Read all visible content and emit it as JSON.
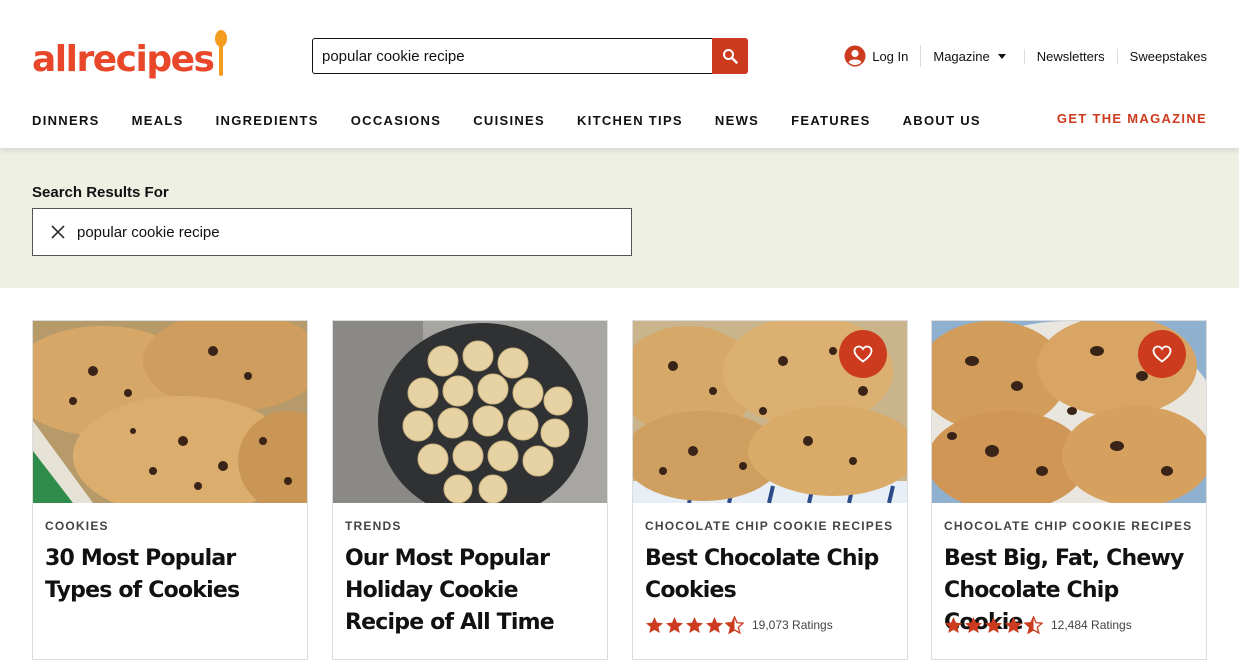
{
  "header": {
    "logo_text": "allrecipes",
    "search": {
      "value": "popular cookie recipe",
      "placeholder": ""
    },
    "util": {
      "login": "Log In",
      "magazine": "Magazine",
      "newsletters": "Newsletters",
      "sweepstakes": "Sweepstakes"
    },
    "nav": [
      "DINNERS",
      "MEALS",
      "INGREDIENTS",
      "OCCASIONS",
      "CUISINES",
      "KITCHEN TIPS",
      "NEWS",
      "FEATURES",
      "ABOUT US"
    ],
    "cta": "GET THE MAGAZINE"
  },
  "results": {
    "label": "Search Results For",
    "query": "popular cookie recipe"
  },
  "cards": [
    {
      "category": "COOKIES",
      "title": "30 Most Popular Types of Cookies",
      "has_heart": false,
      "stars": null,
      "ratings": null,
      "image": "chocolate-chip-cookies-closeup"
    },
    {
      "category": "TRENDS",
      "title": "Our Most Popular Holiday Cookie Recipe of All Time",
      "has_heart": false,
      "stars": null,
      "ratings": null,
      "image": "sugar-cookies-on-plate"
    },
    {
      "category": "CHOCOLATE CHIP COOKIE RECIPES",
      "title": "Best Chocolate Chip Cookies",
      "has_heart": true,
      "stars": 4.5,
      "ratings": "19,073 Ratings",
      "image": "chocolate-chip-cookies-pile"
    },
    {
      "category": "CHOCOLATE CHIP COOKIE RECIPES",
      "title": "Best Big, Fat, Chewy Chocolate Chip Cookie",
      "has_heart": true,
      "stars": 4.5,
      "ratings": "12,484 Ratings",
      "image": "big-chewy-cookies"
    }
  ],
  "colors": {
    "brand": "#e8472a",
    "accent": "#cc3b1e",
    "band": "#eff0e4",
    "spoon": "#f39c1f"
  },
  "icons": [
    "search-icon",
    "user-icon",
    "chevron-down-icon",
    "close-icon",
    "heart-icon",
    "star-icon",
    "half-star-icon"
  ]
}
